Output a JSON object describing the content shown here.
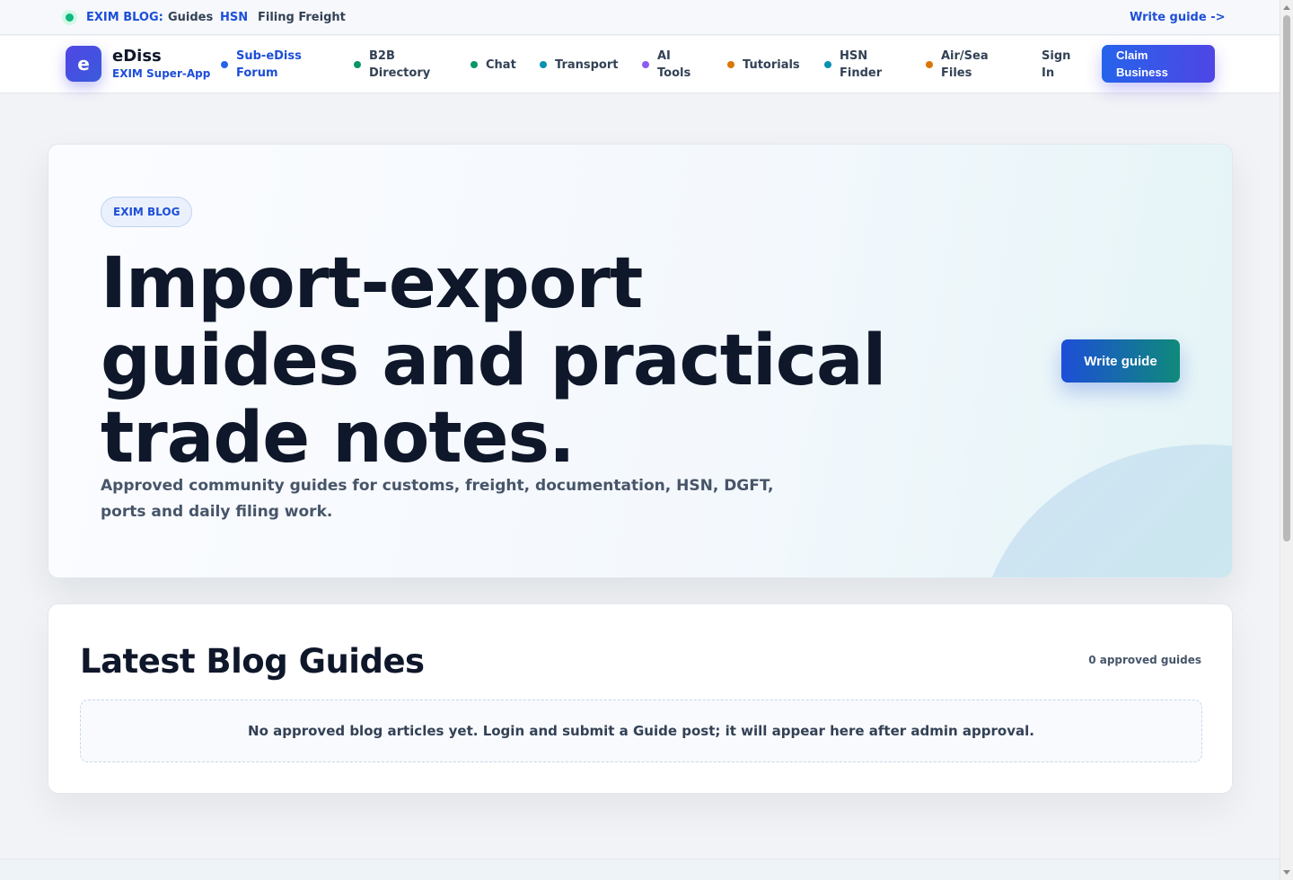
{
  "topbar": {
    "brand": "EXIM BLOG:",
    "links": [
      "Guides",
      "HSN",
      "Filing Freight"
    ],
    "write_link": "Write guide ->"
  },
  "nav": {
    "logo_letter": "e",
    "logo_name": "eDiss",
    "logo_sub": "EXIM Super-App",
    "items": [
      {
        "label": "Sub-eDiss Forum",
        "dot_color": "#2563eb"
      },
      {
        "label": "B2B Directory",
        "dot_color": "#059669"
      },
      {
        "label": "Chat",
        "dot_color": "#059669"
      },
      {
        "label": "Transport",
        "dot_color": "#0891b2"
      },
      {
        "label": "AI Tools",
        "dot_color": "#8b5cf6"
      },
      {
        "label": "Tutorials",
        "dot_color": "#d97706"
      },
      {
        "label": "HSN Finder",
        "dot_color": "#0891b2"
      },
      {
        "label": "Air/Sea Files",
        "dot_color": "#d97706"
      }
    ],
    "sign_in": "Sign In",
    "claim": "Claim Business"
  },
  "hero": {
    "pill": "EXIM BLOG",
    "title": "Import-export guides and practical trade notes.",
    "description": "Approved community guides for customs, freight, documentation, HSN, DGFT, ports and daily filing work.",
    "button": "Write guide"
  },
  "latest": {
    "title": "Latest Blog Guides",
    "count": "0 approved guides",
    "empty_message": "No approved blog articles yet. Login and submit a Guide post; it will appear here after admin approval."
  },
  "colors": {
    "primary": "#1d4ed8",
    "indigo": "#4f46e5",
    "teal": "#0f8a7a",
    "text": "#0f172a",
    "muted": "#475569"
  }
}
